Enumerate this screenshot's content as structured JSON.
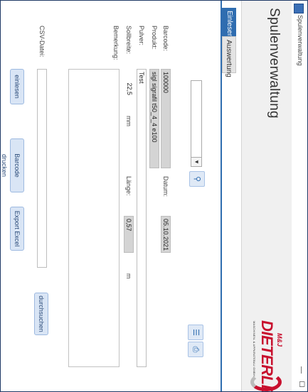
{
  "window": {
    "title": "Spulenverwaltung",
    "minimize_glyph": "—",
    "maximize_glyph": "☐"
  },
  "header": {
    "title": "Spulenverwaltung",
    "logo": {
      "brand_small": "M&J",
      "brand": "DIETERLE",
      "tagline": "MASCHINEN- & APPARATEBAU GMBH"
    }
  },
  "tabs": [
    {
      "label": "Einlesen",
      "active": true
    },
    {
      "label": "Auswertung",
      "active": false
    }
  ],
  "form": {
    "labels": {
      "barcode": "Barcode:",
      "produkt": "Produkt:",
      "pulver": "Pulver:",
      "sollbreite": "Sollbreite:",
      "bemerkung": "Bemerkung:",
      "datum": "Datum:",
      "laenge": "Länge:",
      "mm": "mm",
      "m": "m",
      "csv": "CSV-Datei:"
    },
    "values": {
      "barcode": "100000",
      "produkt": "sigl sigrafil t50_4_4 e100",
      "pulver": "Test",
      "sollbreite": "22,5",
      "datum": "05.10.2021",
      "laenge": "0,57"
    }
  },
  "buttons": {
    "einlesen": "einlesen",
    "barcode_drucken": "Barcode drucken",
    "export_excel": "Export Excel",
    "durchsuchen": "durchsuchen"
  },
  "icons": {
    "select_arrow": "chevron-down-icon",
    "search": "search-icon",
    "document": "document-icon",
    "printer": "print-icon"
  },
  "colors": {
    "accent": "#2f6db0",
    "brand_red": "#c8102e",
    "readonly_field": "#d4d4d4"
  }
}
